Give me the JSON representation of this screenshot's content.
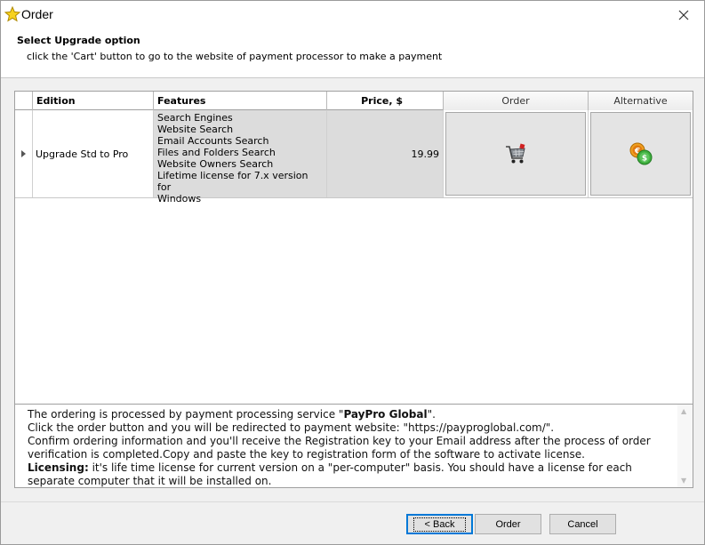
{
  "window": {
    "title": "Order"
  },
  "header": {
    "title": "Select Upgrade option",
    "subtitle": "click the 'Cart' button to go to the website of payment processor to make a payment"
  },
  "grid": {
    "columns": {
      "edition": "Edition",
      "features": "Features",
      "price": "Price, $",
      "order": "Order",
      "alternative": "Alternative"
    },
    "rows": [
      {
        "edition": "Upgrade Std to Pro",
        "features": [
          "Search Engines",
          "Website Search",
          "Email Accounts Search",
          "Files and Folders Search",
          "Website Owners Search",
          "Lifetime license for 7.x version for",
          "Windows"
        ],
        "price": "19.99"
      }
    ]
  },
  "info": {
    "line1_prefix": "The ordering is processed by payment processing service \"",
    "line1_brand": "PayPro Global",
    "line1_suffix": "\".",
    "line2": "Click the order button and you will be redirected to payment website: \"https://payproglobal.com/\".",
    "line3": "Confirm ordering information and you'll receive the Registration key to your Email address after the process of order verification is completed.Copy and paste the key to registration form of the software to activate license.",
    "licensing_label": "Licensing:",
    "licensing_text": " it's life time license for current version on a \"per-computer\" basis. You should have a license for each separate computer that it will be installed on."
  },
  "buttons": {
    "back": "< Back",
    "order": "Order",
    "cancel": "Cancel"
  }
}
